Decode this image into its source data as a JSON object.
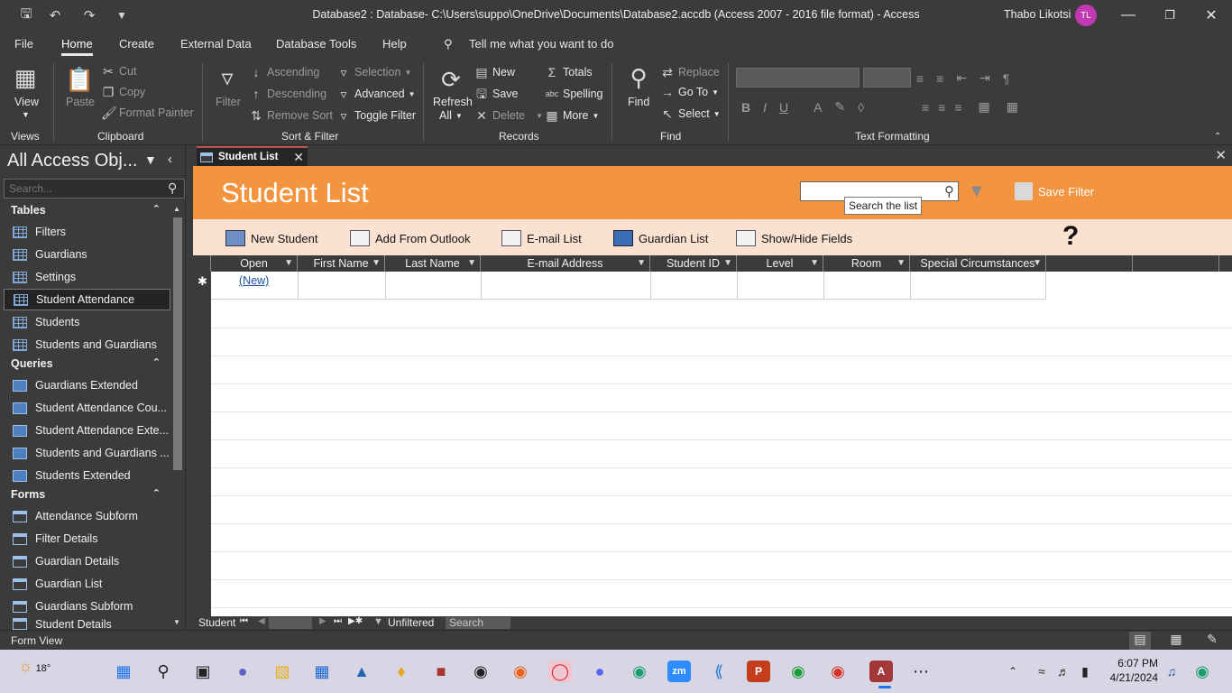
{
  "window": {
    "title": "Database2 : Database- C:\\Users\\suppo\\OneDrive\\Documents\\Database2.accdb (Access 2007 - 2016 file format)  -  Access",
    "user": "Thabo Likotsi",
    "user_initials": "TL"
  },
  "menu": [
    "File",
    "Home",
    "Create",
    "External Data",
    "Database Tools",
    "Help"
  ],
  "tell_me": "Tell me what you want to do",
  "ribbon": {
    "views": {
      "view": "View",
      "label": "Views"
    },
    "clipboard": {
      "paste": "Paste",
      "cut": "Cut",
      "copy": "Copy",
      "format_painter": "Format Painter",
      "label": "Clipboard"
    },
    "sort_filter": {
      "filter": "Filter",
      "ascending": "Ascending",
      "descending": "Descending",
      "remove_sort": "Remove Sort",
      "selection": "Selection",
      "advanced": "Advanced",
      "toggle_filter": "Toggle Filter",
      "label": "Sort & Filter"
    },
    "records": {
      "refresh": "Refresh",
      "refresh_all": "All",
      "new": "New",
      "save": "Save",
      "delete": "Delete",
      "totals": "Totals",
      "spelling": "Spelling",
      "more": "More",
      "label": "Records"
    },
    "find": {
      "find": "Find",
      "replace": "Replace",
      "go_to": "Go To",
      "select": "Select",
      "label": "Find"
    },
    "text_formatting": {
      "label": "Text Formatting"
    }
  },
  "nav": {
    "title": "All Access Obj...",
    "search_placeholder": "Search...",
    "tables_label": "Tables",
    "tables": [
      "Filters",
      "Guardians",
      "Settings",
      "Student Attendance",
      "Students",
      "Students and Guardians"
    ],
    "queries_label": "Queries",
    "queries": [
      "Guardians Extended",
      "Student Attendance Cou...",
      "Student Attendance Exte...",
      "Students and Guardians ...",
      "Students Extended"
    ],
    "forms_label": "Forms",
    "forms": [
      "Attendance Subform",
      "Filter Details",
      "Guardian Details",
      "Guardian List",
      "Guardians Subform",
      "Student Details"
    ]
  },
  "document": {
    "tab": "Student List",
    "form_title": "Student List",
    "search_tooltip": "Search the list",
    "save_filter": "Save Filter",
    "toolbar": [
      "New Student",
      "Add From Outlook",
      "E-mail List",
      "Guardian List",
      "Show/Hide Fields"
    ],
    "help": "?",
    "columns": [
      "Open",
      "First Name",
      "Last Name",
      "E-mail Address",
      "Student ID",
      "Level",
      "Room",
      "Special Circumstances"
    ],
    "new_row_link": "(New)",
    "new_row_marker": "✱"
  },
  "record_nav": {
    "label": "Student",
    "filter_state": "Unfiltered",
    "search": "Search"
  },
  "status": {
    "text": "Form View"
  },
  "taskbar": {
    "weather": "18°",
    "time": "6:07 PM",
    "date": "4/21/2024"
  },
  "colors": {
    "form_header": "#f29440",
    "form_toolbar": "#fbe2d0",
    "chrome": "#3b3b3b",
    "accent_tab": "#c0504d"
  }
}
